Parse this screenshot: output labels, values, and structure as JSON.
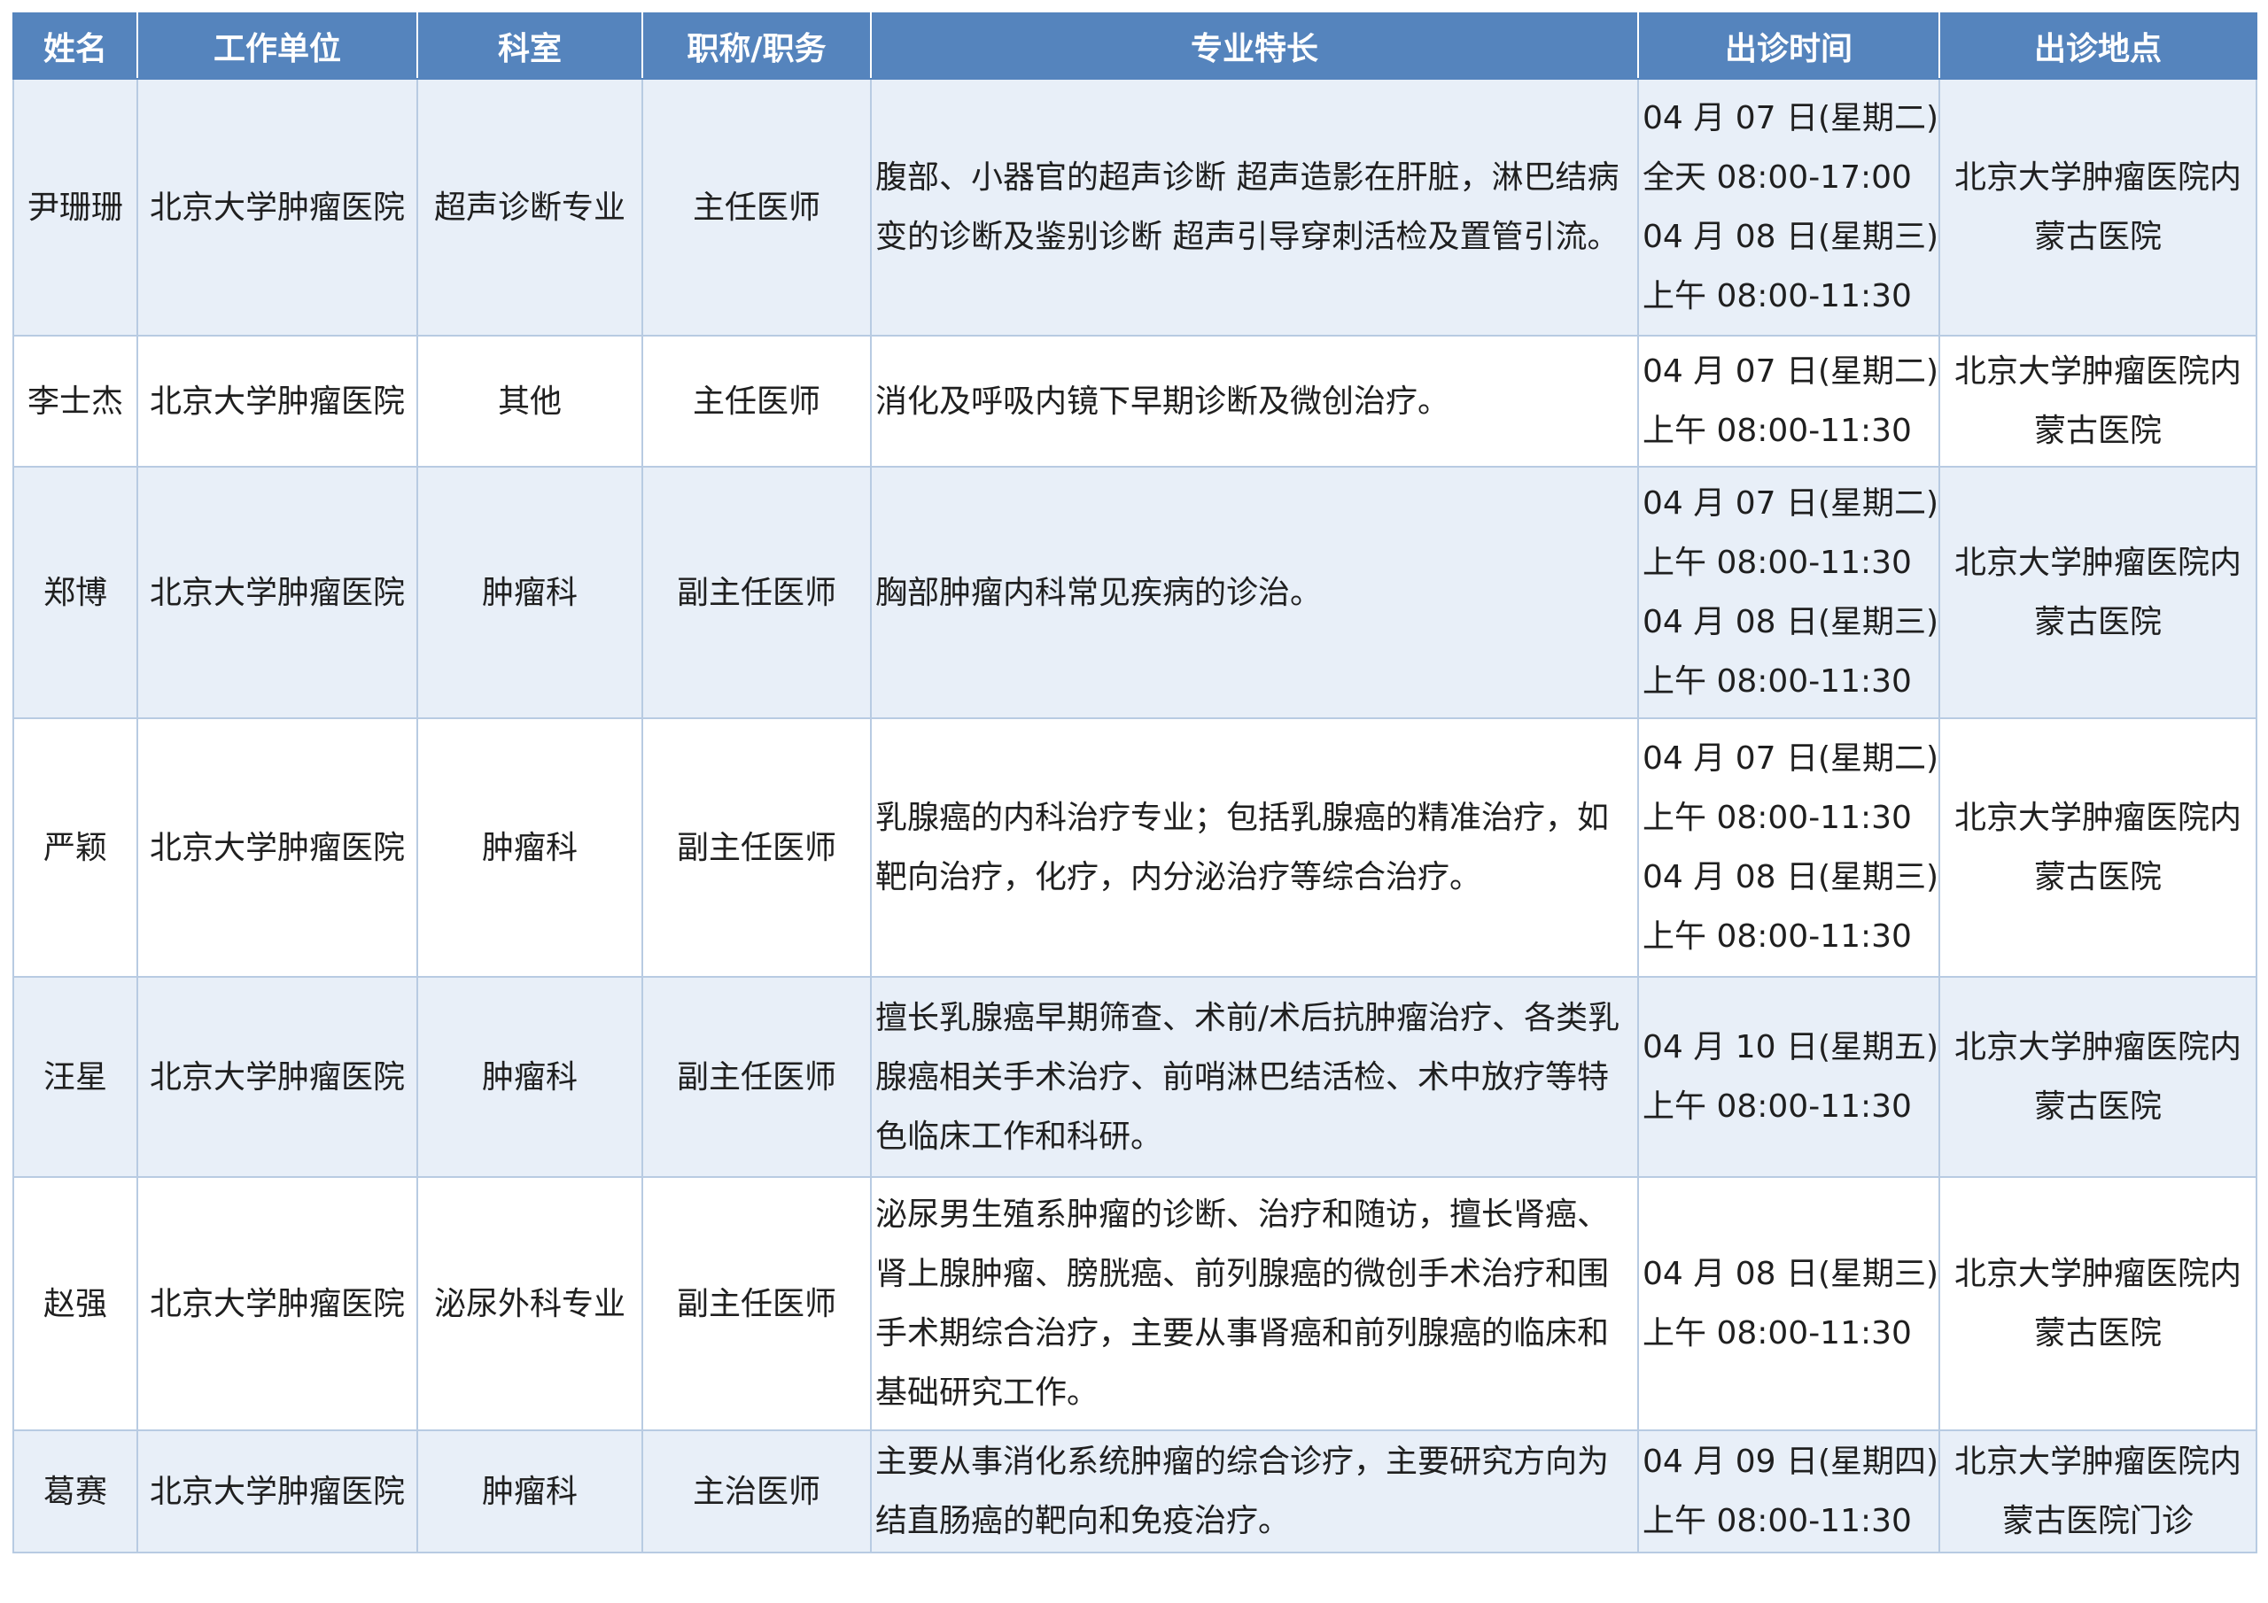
{
  "table": {
    "headers": [
      "姓名",
      "工作单位",
      "科室",
      "职称/职务",
      "专业特长",
      "出诊时间",
      "出诊地点"
    ],
    "rows": [
      {
        "name": "尹珊珊",
        "org": "北京大学肿瘤医院",
        "dept": "超声诊断专业",
        "title": "主任医师",
        "spec": [
          "腹部、小器官的超声诊断 超声造影在肝脏，淋巴结病",
          "变的诊断及鉴别诊断 超声引导穿刺活检及置管引流。"
        ],
        "time": [
          "04 月 07 日(星期二)",
          "全天 08:00-17:00",
          "04 月 08 日(星期三)",
          "上午 08:00-11:30"
        ],
        "loc": [
          "北京大学肿瘤医院内",
          "蒙古医院"
        ]
      },
      {
        "name": "李士杰",
        "org": "北京大学肿瘤医院",
        "dept": "其他",
        "title": "主任医师",
        "spec": [
          "消化及呼吸内镜下早期诊断及微创治疗。"
        ],
        "time": [
          "04 月 07 日(星期二)",
          "上午 08:00-11:30"
        ],
        "loc": [
          "北京大学肿瘤医院内",
          "蒙古医院"
        ]
      },
      {
        "name": "郑博",
        "org": "北京大学肿瘤医院",
        "dept": "肿瘤科",
        "title": "副主任医师",
        "spec": [
          "胸部肿瘤内科常见疾病的诊治。"
        ],
        "time": [
          "04 月 07 日(星期二)",
          "上午 08:00-11:30",
          "04 月 08 日(星期三)",
          "上午 08:00-11:30"
        ],
        "loc": [
          "北京大学肿瘤医院内",
          "蒙古医院"
        ]
      },
      {
        "name": "严颖",
        "org": "北京大学肿瘤医院",
        "dept": "肿瘤科",
        "title": "副主任医师",
        "spec": [
          "乳腺癌的内科治疗专业；包括乳腺癌的精准治疗，如",
          "靶向治疗，化疗，内分泌治疗等综合治疗。"
        ],
        "time": [
          "04 月 07 日(星期二)",
          "上午 08:00-11:30",
          "04 月 08 日(星期三)",
          "上午 08:00-11:30"
        ],
        "loc": [
          "北京大学肿瘤医院内",
          "蒙古医院"
        ]
      },
      {
        "name": "汪星",
        "org": "北京大学肿瘤医院",
        "dept": "肿瘤科",
        "title": "副主任医师",
        "spec": [
          "擅长乳腺癌早期筛查、术前/术后抗肿瘤治疗、各类乳",
          "腺癌相关手术治疗、前哨淋巴结活检、术中放疗等特",
          "色临床工作和科研。"
        ],
        "time": [
          "04 月 10 日(星期五)",
          "上午 08:00-11:30"
        ],
        "loc": [
          "北京大学肿瘤医院内",
          "蒙古医院"
        ]
      },
      {
        "name": "赵强",
        "org": "北京大学肿瘤医院",
        "dept": "泌尿外科专业",
        "title": "副主任医师",
        "spec": [
          "泌尿男生殖系肿瘤的诊断、治疗和随访，擅长肾癌、",
          "肾上腺肿瘤、膀胱癌、前列腺癌的微创手术治疗和围",
          "手术期综合治疗，主要从事肾癌和前列腺癌的临床和",
          "基础研究工作。"
        ],
        "time": [
          "04 月 08 日(星期三)",
          "上午 08:00-11:30"
        ],
        "loc": [
          "北京大学肿瘤医院内",
          "蒙古医院"
        ]
      },
      {
        "name": "葛赛",
        "org": "北京大学肿瘤医院",
        "dept": "肿瘤科",
        "title": "主治医师",
        "spec": [
          "主要从事消化系统肿瘤的综合诊疗，主要研究方向为",
          "结直肠癌的靶向和免疫治疗。"
        ],
        "time": [
          "04 月 09 日(星期四)",
          "上午 08:00-11:30"
        ],
        "loc": [
          "北京大学肿瘤医院内",
          "蒙古医院门诊"
        ]
      }
    ]
  }
}
